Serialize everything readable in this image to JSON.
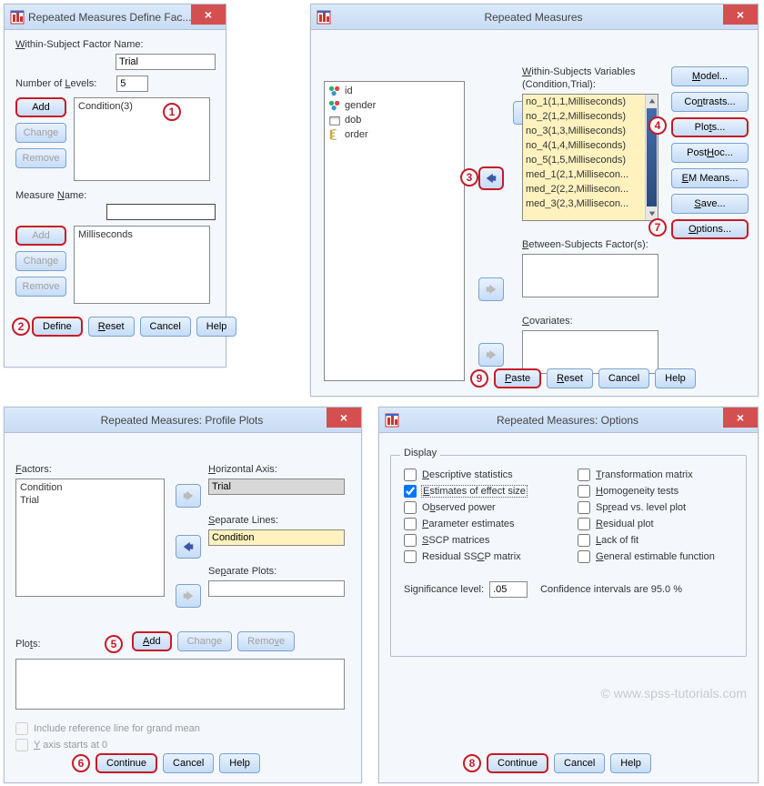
{
  "dlg1": {
    "title": "Repeated Measures Define Fac...",
    "wsf_label": "Within-Subject Factor Name:",
    "wsf_label_u": "W",
    "wsf_value": "Trial",
    "lvl_label": "Number of Levels:",
    "lvl_label_u": "L",
    "lvl_value": "5",
    "add_btn": "Add",
    "change_btn": "Change",
    "remove_btn": "Remove",
    "factor_list_item": "Condition(3)",
    "measure_label": "Measure Name:",
    "measure_label_u": "N",
    "measure_list_item": "Milliseconds",
    "define_btn": "Define",
    "reset_btn": "Reset",
    "cancel_btn": "Cancel",
    "help_btn": "Help"
  },
  "dlg2": {
    "title": "Repeated Measures",
    "src_items": [
      "id",
      "gender",
      "dob",
      "order"
    ],
    "wsv_label": "Within-Subjects Variables",
    "wsv_sub": "(Condition,Trial):",
    "wsv_items": [
      "no_1(1,1,Milliseconds)",
      "no_2(1,2,Milliseconds)",
      "no_3(1,3,Milliseconds)",
      "no_4(1,4,Milliseconds)",
      "no_5(1,5,Milliseconds)",
      "med_1(2,1,Millisecon...",
      "med_2(2,2,Millisecon...",
      "med_3(2,3,Millisecon..."
    ],
    "bsf_label": "Between-Subjects Factor(s):",
    "cov_label": "Covariates:",
    "side": {
      "model": "Model...",
      "contrasts": "Contrasts...",
      "plots": "Plots...",
      "posthoc": "Post Hoc...",
      "emmeans": "EM Means...",
      "save": "Save...",
      "options": "Options..."
    },
    "paste_btn": "Paste",
    "reset_btn": "Reset",
    "cancel_btn": "Cancel",
    "help_btn": "Help"
  },
  "dlg3": {
    "title": "Repeated Measures: Profile Plots",
    "factors_label": "Factors:",
    "factors_label_u": "F",
    "factor_items": [
      "Condition",
      "Trial"
    ],
    "haxis_label": "Horizontal Axis:",
    "haxis_label_u": "H",
    "haxis_value": "Trial",
    "sep_lines_label": "Separate Lines:",
    "sep_lines_value": "Condition",
    "sep_plots_label": "Separate Plots:",
    "plots_label": "Plots:",
    "plots_label_u": "t",
    "add_btn": "Add",
    "change_btn": "Change",
    "remove_btn": "Remove",
    "ref_line_label": "Include reference line for grand mean",
    "yzero_label": "Y axis starts at 0",
    "yzero_u": "Y",
    "continue_btn": "Continue",
    "cancel_btn": "Cancel",
    "help_btn": "Help"
  },
  "dlg4": {
    "title": "Repeated Measures: Options",
    "display_label": "Display",
    "opts": {
      "desc": "Descriptive statistics",
      "effect": "Estimates of effect size",
      "power": "Observed power",
      "param": "Parameter estimates",
      "sscp": "SSCP matrices",
      "rsscp": "Residual SSCP matrix",
      "trans": "Transformation matrix",
      "homo": "Homogeneity tests",
      "spread": "Spread vs. level plot",
      "res": "Residual plot",
      "lack": "Lack of fit",
      "gen": "General estimable function"
    },
    "sig_label": "Significance level:",
    "sig_value": ".05",
    "conf_label": "Confidence intervals are 95.0 %",
    "continue_btn": "Continue",
    "cancel_btn": "Cancel",
    "help_btn": "Help"
  },
  "watermark": "© www.spss-tutorials.com",
  "callouts": {
    "c1": "1",
    "c2": "2",
    "c3": "3",
    "c4": "4",
    "c5": "5",
    "c6": "6",
    "c7": "7",
    "c8": "8",
    "c9": "9"
  }
}
